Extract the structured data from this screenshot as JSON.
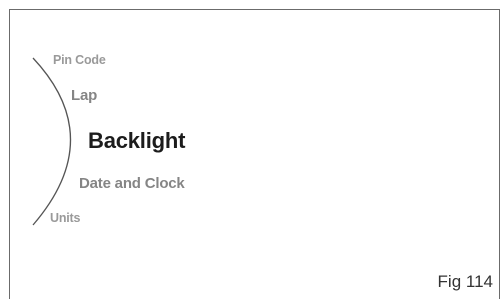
{
  "menu": {
    "items": [
      {
        "label": "Pin Code"
      },
      {
        "label": "Lap"
      },
      {
        "label": "Backlight"
      },
      {
        "label": "Date and Clock"
      },
      {
        "label": "Units"
      }
    ],
    "selected": "Backlight"
  },
  "caption": "Fig 114"
}
